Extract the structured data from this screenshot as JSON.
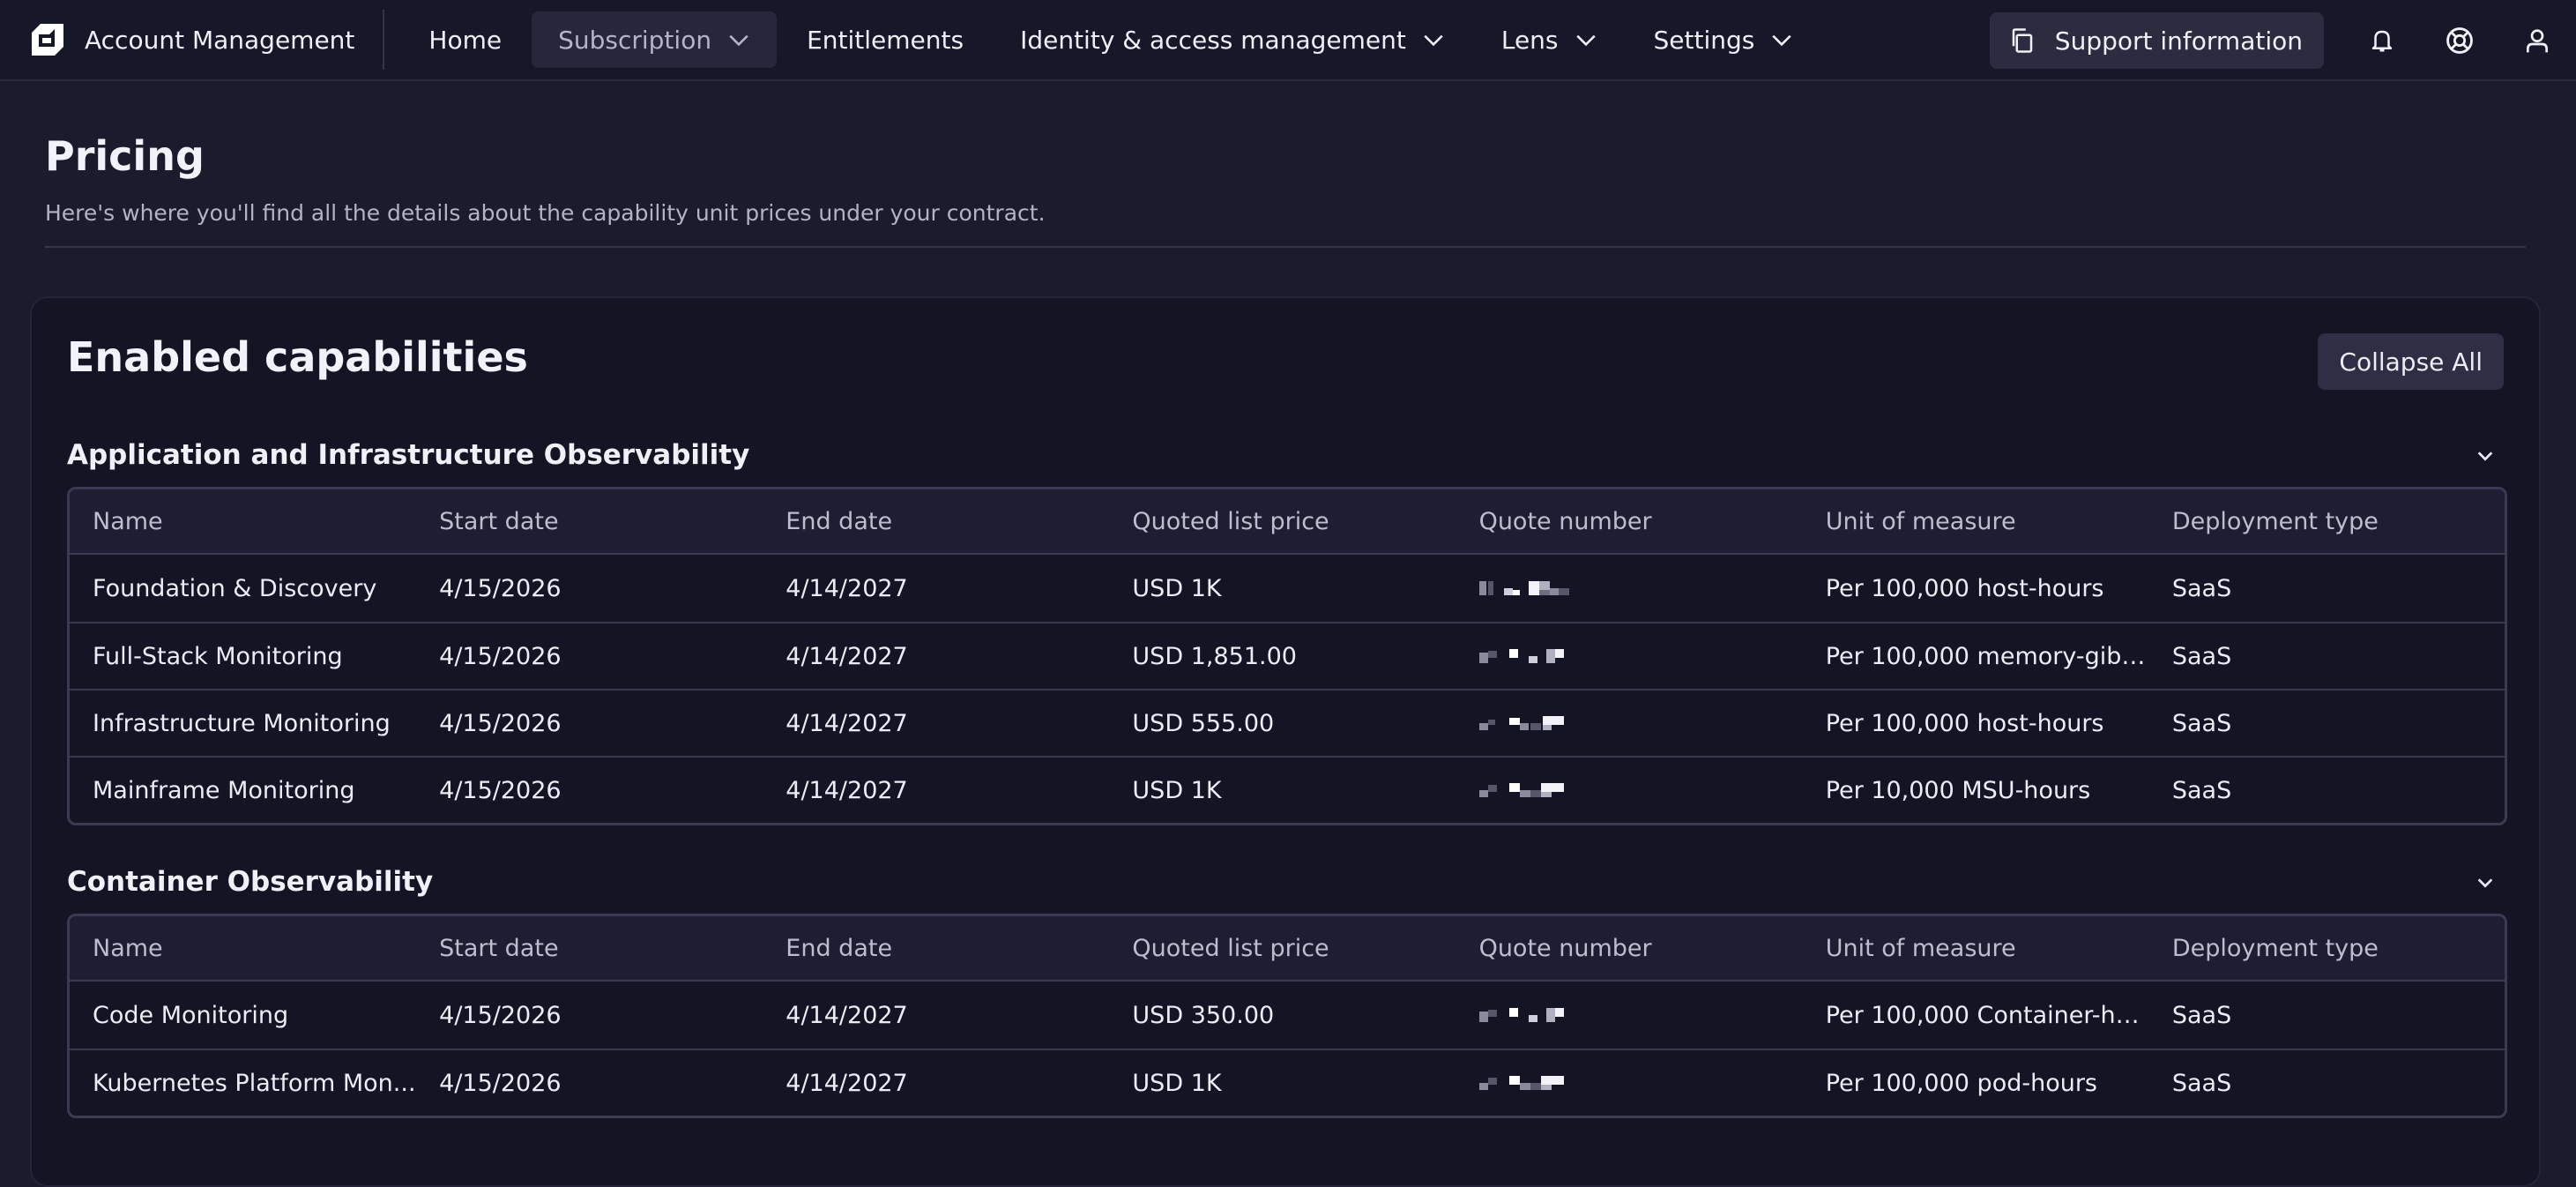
{
  "app": {
    "title": "Account Management"
  },
  "nav": {
    "items": [
      {
        "label": "Home"
      },
      {
        "label": "Subscription"
      },
      {
        "label": "Entitlements"
      },
      {
        "label": "Identity & access management"
      },
      {
        "label": "Lens"
      },
      {
        "label": "Settings"
      }
    ],
    "support_label": "Support information"
  },
  "page": {
    "title": "Pricing",
    "subtitle": "Here's where you'll find all the details about the capability unit prices under your contract."
  },
  "card": {
    "title": "Enabled capabilities",
    "collapse_label": "Collapse All"
  },
  "columns": [
    "Name",
    "Start date",
    "End date",
    "Quoted list price",
    "Quote number",
    "Unit of measure",
    "Deployment type"
  ],
  "sections": [
    {
      "title": "Application and Infrastructure Observability",
      "rows": [
        {
          "name": "Foundation & Discovery",
          "start": "4/15/2026",
          "end": "4/14/2027",
          "price": "USD 1K",
          "quote": "",
          "unit": "Per 100,000 host-hours",
          "deployment": "SaaS"
        },
        {
          "name": "Full-Stack Monitoring",
          "start": "4/15/2026",
          "end": "4/14/2027",
          "price": "USD 1,851.00",
          "quote": "",
          "unit": "Per 100,000 memory-gibi...",
          "deployment": "SaaS"
        },
        {
          "name": "Infrastructure Monitoring",
          "start": "4/15/2026",
          "end": "4/14/2027",
          "price": "USD 555.00",
          "quote": "",
          "unit": "Per 100,000 host-hours",
          "deployment": "SaaS"
        },
        {
          "name": "Mainframe Monitoring",
          "start": "4/15/2026",
          "end": "4/14/2027",
          "price": "USD 1K",
          "quote": "",
          "unit": "Per 10,000 MSU-hours",
          "deployment": "SaaS"
        }
      ]
    },
    {
      "title": "Container Observability",
      "rows": [
        {
          "name": "Code Monitoring",
          "start": "4/15/2026",
          "end": "4/14/2027",
          "price": "USD 350.00",
          "quote": "",
          "unit": "Per 100,000 Container-ho...",
          "deployment": "SaaS"
        },
        {
          "name": "Kubernetes Platform Mon...",
          "start": "4/15/2026",
          "end": "4/14/2027",
          "price": "USD 1K",
          "quote": "",
          "unit": "Per 100,000 pod-hours",
          "deployment": "SaaS"
        }
      ]
    }
  ],
  "colors": {
    "page_bg": "#1b1b2e",
    "card_bg": "#141424",
    "nav_bg": "#17172a",
    "accent_button": "#2e2e44"
  },
  "icons": {
    "logo": "dynatrace-logo-icon",
    "nav_dropdown": "chevron-down-icon",
    "support": "copy-icon",
    "notifications": "bell-icon",
    "help": "lifebuoy-icon",
    "user": "user-icon",
    "section_toggle": "chevron-down-icon"
  }
}
